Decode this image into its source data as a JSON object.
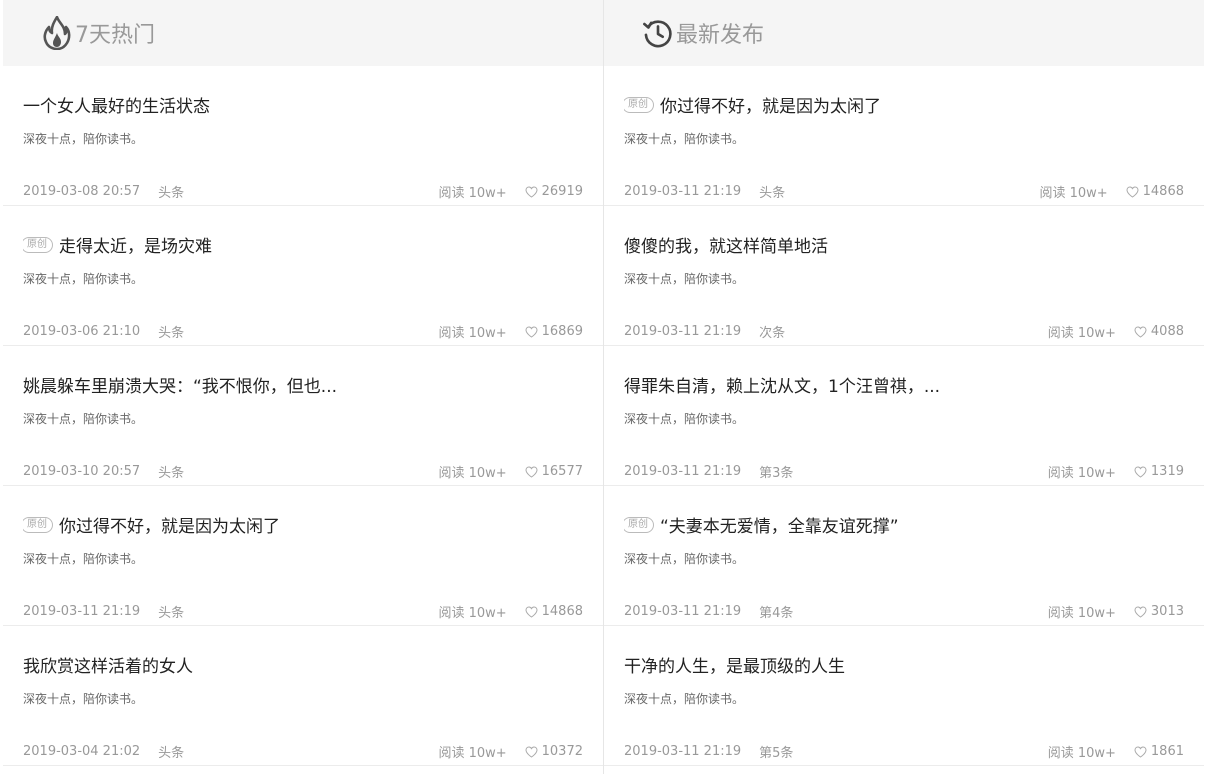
{
  "left": {
    "title": "7天热门",
    "icon": "fire-icon",
    "items": [
      {
        "original": false,
        "title": "一个女人最好的生活状态",
        "source": "深夜十点，陪你读书。",
        "date": "2019-03-08 20:57",
        "position": "头条",
        "reads": "阅读 10w+",
        "likes": "26919"
      },
      {
        "original": true,
        "title": "走得太近，是场灾难",
        "source": "深夜十点，陪你读书。",
        "date": "2019-03-06 21:10",
        "position": "头条",
        "reads": "阅读 10w+",
        "likes": "16869"
      },
      {
        "original": false,
        "title": "姚晨躲车里崩溃大哭：“我不恨你，但也...",
        "source": "深夜十点，陪你读书。",
        "date": "2019-03-10 20:57",
        "position": "头条",
        "reads": "阅读 10w+",
        "likes": "16577"
      },
      {
        "original": true,
        "title": "你过得不好，就是因为太闲了",
        "source": "深夜十点，陪你读书。",
        "date": "2019-03-11 21:19",
        "position": "头条",
        "reads": "阅读 10w+",
        "likes": "14868"
      },
      {
        "original": false,
        "title": "我欣赏这样活着的女人",
        "source": "深夜十点，陪你读书。",
        "date": "2019-03-04 21:02",
        "position": "头条",
        "reads": "阅读 10w+",
        "likes": "10372"
      }
    ]
  },
  "right": {
    "title": "最新发布",
    "icon": "history-clock-icon",
    "items": [
      {
        "original": true,
        "title": "你过得不好，就是因为太闲了",
        "source": "深夜十点，陪你读书。",
        "date": "2019-03-11 21:19",
        "position": "头条",
        "reads": "阅读 10w+",
        "likes": "14868"
      },
      {
        "original": false,
        "title": "傻傻的我，就这样简单地活",
        "source": "深夜十点，陪你读书。",
        "date": "2019-03-11 21:19",
        "position": "次条",
        "reads": "阅读 10w+",
        "likes": "4088"
      },
      {
        "original": false,
        "title": "得罪朱自清，赖上沈从文，1个汪曾祺，...",
        "source": "深夜十点，陪你读书。",
        "date": "2019-03-11 21:19",
        "position": "第3条",
        "reads": "阅读 10w+",
        "likes": "1319"
      },
      {
        "original": true,
        "title": "“夫妻本无爱情，全靠友谊死撑”",
        "source": "深夜十点，陪你读书。",
        "date": "2019-03-11 21:19",
        "position": "第4条",
        "reads": "阅读 10w+",
        "likes": "3013"
      },
      {
        "original": false,
        "title": "干净的人生，是最顶级的人生",
        "source": "深夜十点，陪你读书。",
        "date": "2019-03-11 21:19",
        "position": "第5条",
        "reads": "阅读 10w+",
        "likes": "1861"
      }
    ]
  },
  "tag_original": "原创",
  "colors": {
    "header_bg": "#f5f5f5",
    "header_text": "#999999",
    "title_text": "#222222",
    "meta_text": "#999999",
    "divider": "#ececec"
  }
}
